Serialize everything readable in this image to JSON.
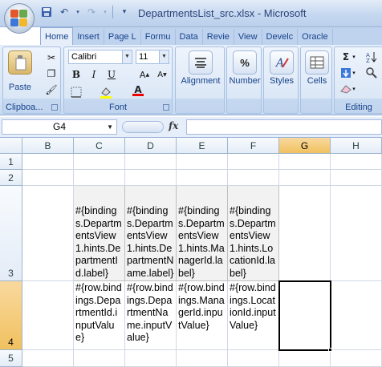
{
  "window": {
    "title": "DepartmentsList_src.xlsx - Microsoft"
  },
  "tabs": [
    "Home",
    "Insert",
    "Page L",
    "Formu",
    "Data",
    "Revie",
    "View",
    "Develc",
    "Oracle"
  ],
  "ribbon": {
    "clipboard": {
      "label": "Clipboa...",
      "paste": "Paste"
    },
    "font": {
      "label": "Font",
      "name": "Calibri",
      "size": "11"
    },
    "alignment": "Alignment",
    "number": "Number",
    "styles": "Styles",
    "cells": "Cells",
    "editing": "Editing"
  },
  "formula_bar": {
    "name_box": "G4",
    "fx": "fx",
    "value": ""
  },
  "grid": {
    "columns": [
      "B",
      "C",
      "D",
      "E",
      "F",
      "G",
      "H"
    ],
    "rows": [
      "1",
      "2",
      "3",
      "4",
      "5"
    ],
    "row3": [
      "#{bindings.DepartmentsView1.hints.DepartmentId.label}",
      "#{bindings.DepartmentsView1.hints.DepartmentName.label}",
      "#{bindings.DepartmentsView1.hints.ManagerId.label}",
      "#{bindings.DepartmentsView1.hints.LocationId.label}"
    ],
    "row4": [
      "#{row.bindings.DepartmentId.inputValue}",
      "#{row.bindings.DepartmentName.inputValue}",
      "#{row.bindings.ManagerId.inputValue}",
      "#{row.bindings.LocationId.inputValue}"
    ]
  },
  "colors": {
    "selection": "#000000",
    "header_selected": "#f1c15f",
    "label_fill": "#f2f2f2"
  }
}
